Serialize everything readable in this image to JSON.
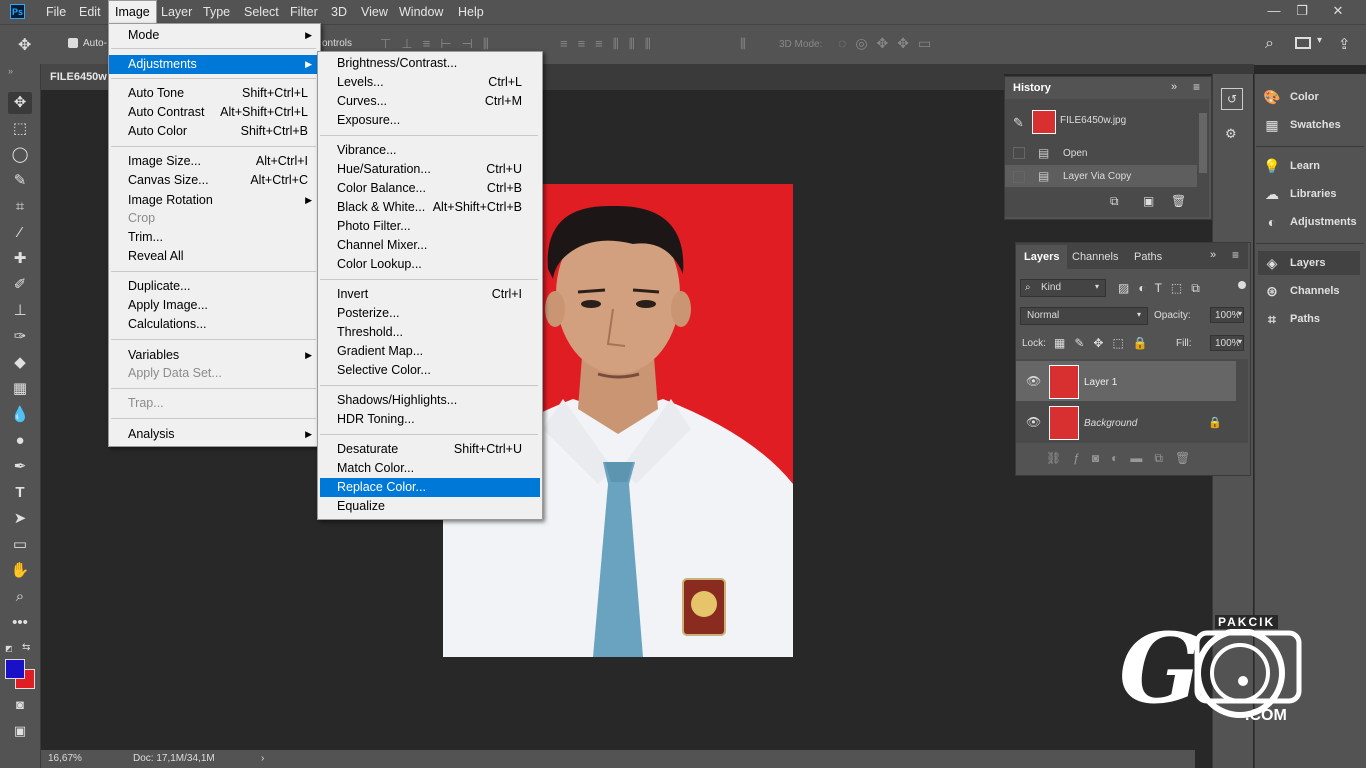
{
  "app": {
    "logo": "Ps"
  },
  "menubar": {
    "items": [
      "File",
      "Edit",
      "Image",
      "Layer",
      "Type",
      "Select",
      "Filter",
      "3D",
      "View",
      "Window",
      "Help"
    ],
    "active": "Image"
  },
  "options": {
    "auto_select": "Auto-",
    "controls_suffix": "ontrols",
    "mode_3d": "3D Mode:"
  },
  "document": {
    "tab_title": "FILE6450w",
    "zoom": "16,67%",
    "doc_info": "Doc: 17,1M/34,1M"
  },
  "image_menu": {
    "mode": "Mode",
    "adjustments": "Adjustments",
    "auto_tone": "Auto Tone",
    "auto_tone_sc": "Shift+Ctrl+L",
    "auto_contrast": "Auto Contrast",
    "auto_contrast_sc": "Alt+Shift+Ctrl+L",
    "auto_color": "Auto Color",
    "auto_color_sc": "Shift+Ctrl+B",
    "image_size": "Image Size...",
    "image_size_sc": "Alt+Ctrl+I",
    "canvas_size": "Canvas Size...",
    "canvas_size_sc": "Alt+Ctrl+C",
    "image_rotation": "Image Rotation",
    "crop": "Crop",
    "trim": "Trim...",
    "reveal_all": "Reveal All",
    "duplicate": "Duplicate...",
    "apply_image": "Apply Image...",
    "calculations": "Calculations...",
    "variables": "Variables",
    "apply_data_set": "Apply Data Set...",
    "trap": "Trap...",
    "analysis": "Analysis"
  },
  "adjustments_menu": {
    "brightness": "Brightness/Contrast...",
    "levels": "Levels...",
    "levels_sc": "Ctrl+L",
    "curves": "Curves...",
    "curves_sc": "Ctrl+M",
    "exposure": "Exposure...",
    "vibrance": "Vibrance...",
    "hue_sat": "Hue/Saturation...",
    "hue_sat_sc": "Ctrl+U",
    "color_balance": "Color Balance...",
    "color_balance_sc": "Ctrl+B",
    "bw": "Black & White...",
    "bw_sc": "Alt+Shift+Ctrl+B",
    "photo_filter": "Photo Filter...",
    "channel_mixer": "Channel Mixer...",
    "color_lookup": "Color Lookup...",
    "invert": "Invert",
    "invert_sc": "Ctrl+I",
    "posterize": "Posterize...",
    "threshold": "Threshold...",
    "gradient_map": "Gradient Map...",
    "selective_color": "Selective Color...",
    "shadows": "Shadows/Highlights...",
    "hdr": "HDR Toning...",
    "desaturate": "Desaturate",
    "desaturate_sc": "Shift+Ctrl+U",
    "match_color": "Match Color...",
    "replace_color": "Replace Color...",
    "equalize": "Equalize"
  },
  "history": {
    "tab": "History",
    "snapshot": "FILE6450w.jpg",
    "items": [
      "Open",
      "Layer Via Copy"
    ]
  },
  "layers": {
    "tabs": [
      "Layers",
      "Channels",
      "Paths"
    ],
    "kind": "Kind",
    "blend_mode": "Normal",
    "opacity_label": "Opacity:",
    "opacity": "100%",
    "lock_label": "Lock:",
    "fill_label": "Fill:",
    "fill": "100%",
    "list": [
      "Layer 1",
      "Background"
    ]
  },
  "dock": {
    "items": [
      "Color",
      "Swatches",
      "Learn",
      "Libraries",
      "Adjustments",
      "Layers",
      "Channels",
      "Paths"
    ]
  },
  "watermark": {
    "top": "PAKCIK",
    "letter": "G",
    "bottom": ".COM"
  },
  "colors": {
    "foreground": "#1a10c8",
    "background": "#e11d24",
    "highlight": "#0078d7"
  }
}
